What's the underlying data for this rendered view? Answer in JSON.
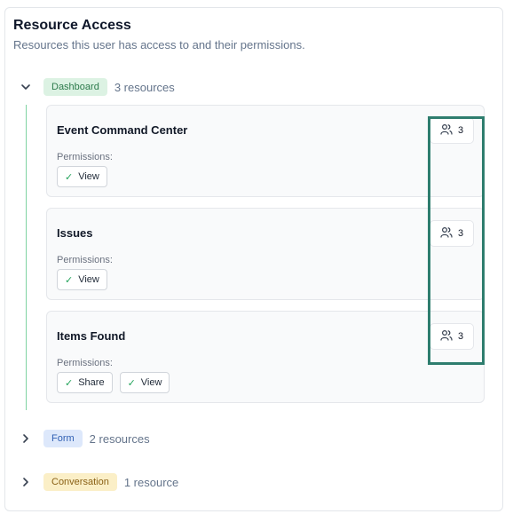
{
  "header": {
    "title": "Resource Access",
    "subtitle": "Resources this user has access to and their permissions."
  },
  "groups": [
    {
      "badge": "Dashboard",
      "count": "3 resources",
      "expanded": true,
      "color": "#2c7a4b",
      "resources": [
        {
          "name": "Event Command Center",
          "permissions_label": "Permissions:",
          "permissions": [
            "View"
          ],
          "users": "3"
        },
        {
          "name": "Issues",
          "permissions_label": "Permissions:",
          "permissions": [
            "View"
          ],
          "users": "3"
        },
        {
          "name": "Items Found",
          "permissions_label": "Permissions:",
          "permissions": [
            "Share",
            "View"
          ],
          "users": "3"
        }
      ]
    },
    {
      "badge": "Form",
      "count": "2 resources",
      "expanded": false,
      "color": "#2f5fb3"
    },
    {
      "badge": "Conversation",
      "count": "1 resource",
      "expanded": false,
      "color": "#8a6116"
    }
  ],
  "icons": {
    "check": "✓",
    "expanded_chevron": "chevron-down-icon",
    "collapsed_chevron": "chevron-right-icon",
    "users": "users-icon"
  }
}
